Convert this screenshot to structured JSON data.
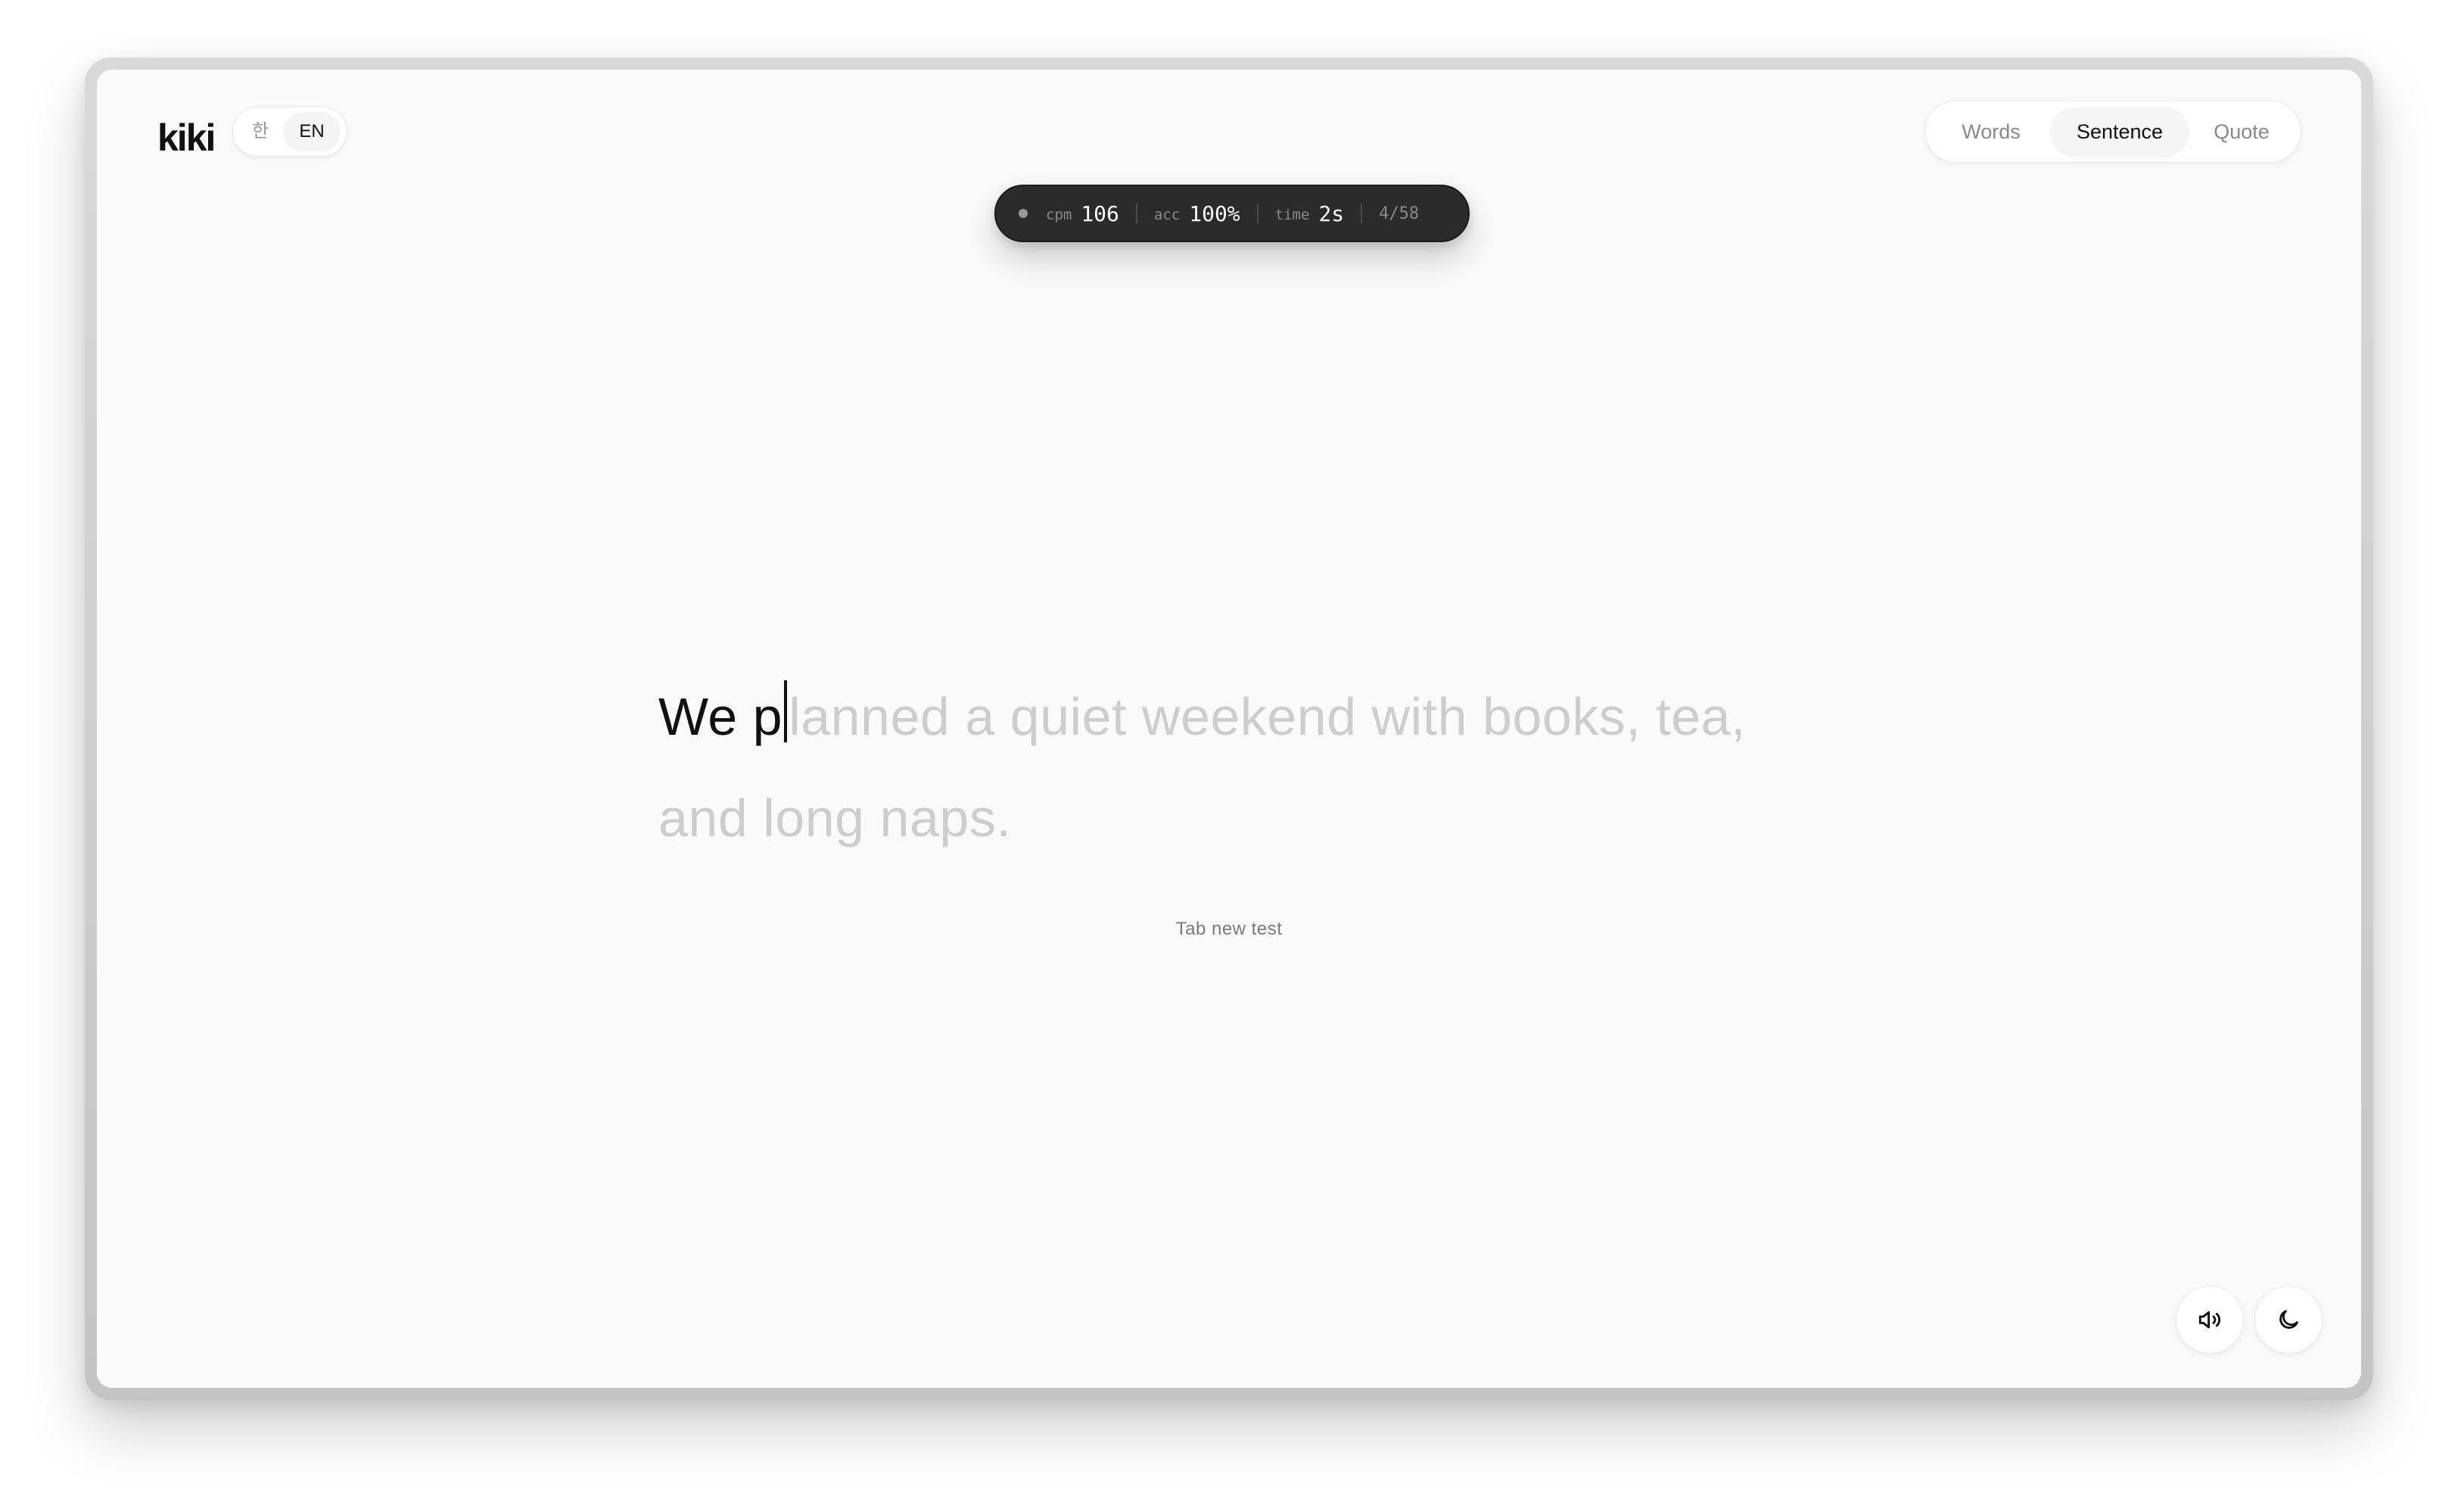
{
  "app": {
    "logo": "kiki"
  },
  "language": {
    "options": [
      "한",
      "EN"
    ],
    "selected": "EN"
  },
  "modes": {
    "tabs": [
      {
        "label": "Words"
      },
      {
        "label": "Sentence"
      },
      {
        "label": "Quote"
      }
    ],
    "selected": "Sentence"
  },
  "stats": {
    "cpm_label": "cpm",
    "cpm_value": "106",
    "acc_label": "acc",
    "acc_value": "100%",
    "time_label": "time",
    "time_value": "2s",
    "progress": "4/58"
  },
  "test": {
    "typed": "We p",
    "remaining": "lanned a quiet weekend with books, tea, and long naps."
  },
  "hint": "Tab new test",
  "icons": {
    "sound": "speaker-icon",
    "theme": "moon-icon"
  }
}
